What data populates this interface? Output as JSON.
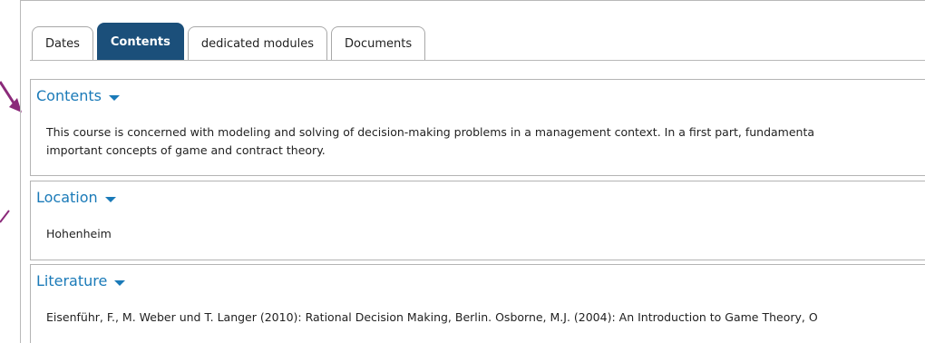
{
  "tabs": [
    {
      "label": "Dates",
      "active": false
    },
    {
      "label": "Contents",
      "active": true
    },
    {
      "label": "dedicated modules",
      "active": false
    },
    {
      "label": "Documents",
      "active": false
    }
  ],
  "sections": {
    "contents": {
      "title": "Contents",
      "lines": [
        "This course is concerned with modeling and solving of decision-making problems in a management context. In a first part, fundamenta",
        "important concepts of game and contract theory."
      ]
    },
    "location": {
      "title": "Location",
      "text": "Hohenheim"
    },
    "literature": {
      "title": "Literature",
      "text": "Eisenführ, F., M. Weber und T. Langer (2010): Rational Decision Making, Berlin. Osborne, M.J. (2004): An Introduction to Game Theory, O"
    }
  },
  "colors": {
    "active_tab": "#1b4f7a",
    "section_title": "#1a7ab8",
    "annotation_arrow": "#8b2a7a"
  },
  "icons": {
    "caret": "chevron-down-icon"
  }
}
